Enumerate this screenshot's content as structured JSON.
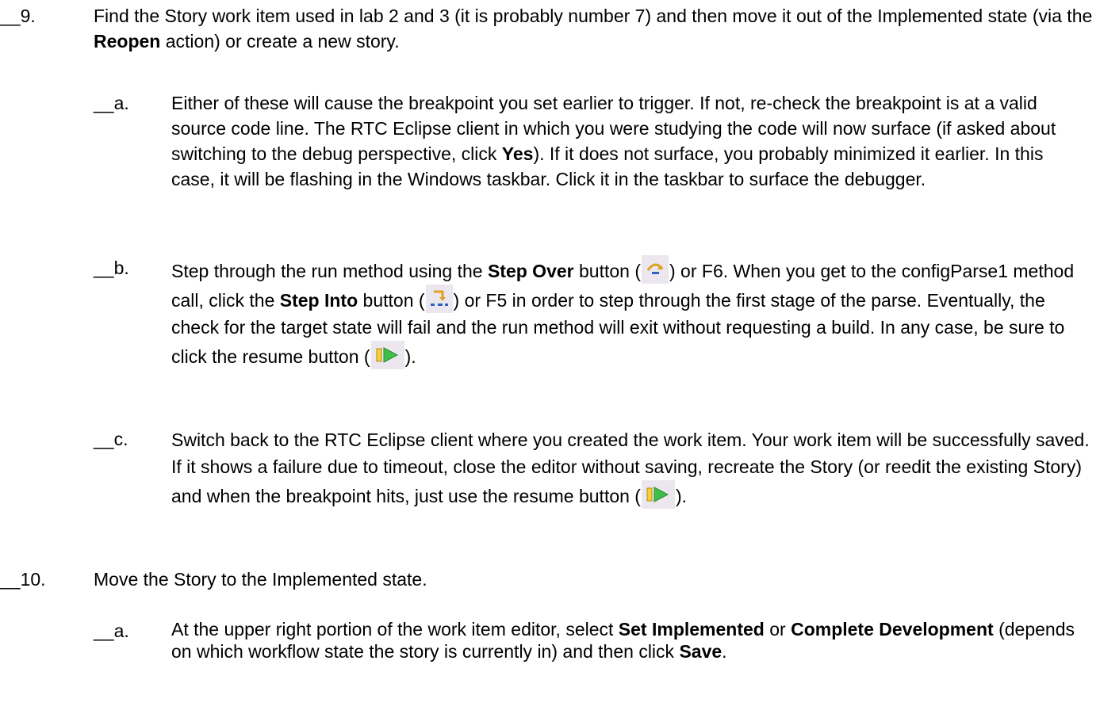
{
  "step9": {
    "num": "__9.",
    "t1": "Find the Story work item used in lab 2 and 3 (it is probably number 7) and then move it out of the Implemented state (via the ",
    "t1b": "Reopen",
    "t1c": " action) or create a new story.",
    "a": {
      "num": "__a.",
      "t1": "Either of these will cause the breakpoint you set earlier to trigger. If not, re-check the breakpoint is at a valid source code line. The RTC Eclipse client in which you were studying the code will now surface (if asked about switching to the debug perspective, click ",
      "t1b": "Yes",
      "t1c": "). If it does not surface, you probably minimized it earlier. In this case, it will be flashing in the Windows taskbar. Click it in the taskbar to surface the debugger."
    },
    "b": {
      "num": "__b.",
      "t1": "Step through the run method using the ",
      "t1b": "Step Over",
      "t2": " button (",
      "t3": ") or F6. When you get to the configParse1 method call, click the ",
      "t3b": "Step Into",
      "t4": " button (",
      "t5": ") or F5 in order to step through the first stage of the parse. Eventually, the check for the target state will fail and the run method will exit without requesting a build. In any case, be sure to click the resume button (",
      "t6": ")."
    },
    "c": {
      "num": "__c.",
      "t1": "Switch back to the RTC Eclipse client where you created the work item. Your work item will be successfully saved. If it shows a failure due to timeout, close the editor without saving, recreate the Story (or reedit the existing Story) and when the breakpoint hits, just use the resume button (",
      "t2": ")."
    }
  },
  "step10": {
    "num": "__10.",
    "t1": "Move the Story to the Implemented state.",
    "a": {
      "num": "__a.",
      "t1": "At the upper right portion of the work item editor, select ",
      "t1b": "Set Implemented",
      "t2": " or ",
      "t2b": "Complete Development",
      "t3": " (depends on which workflow state the story is currently in) and then click ",
      "t3b": "Save",
      "t4": "."
    }
  }
}
